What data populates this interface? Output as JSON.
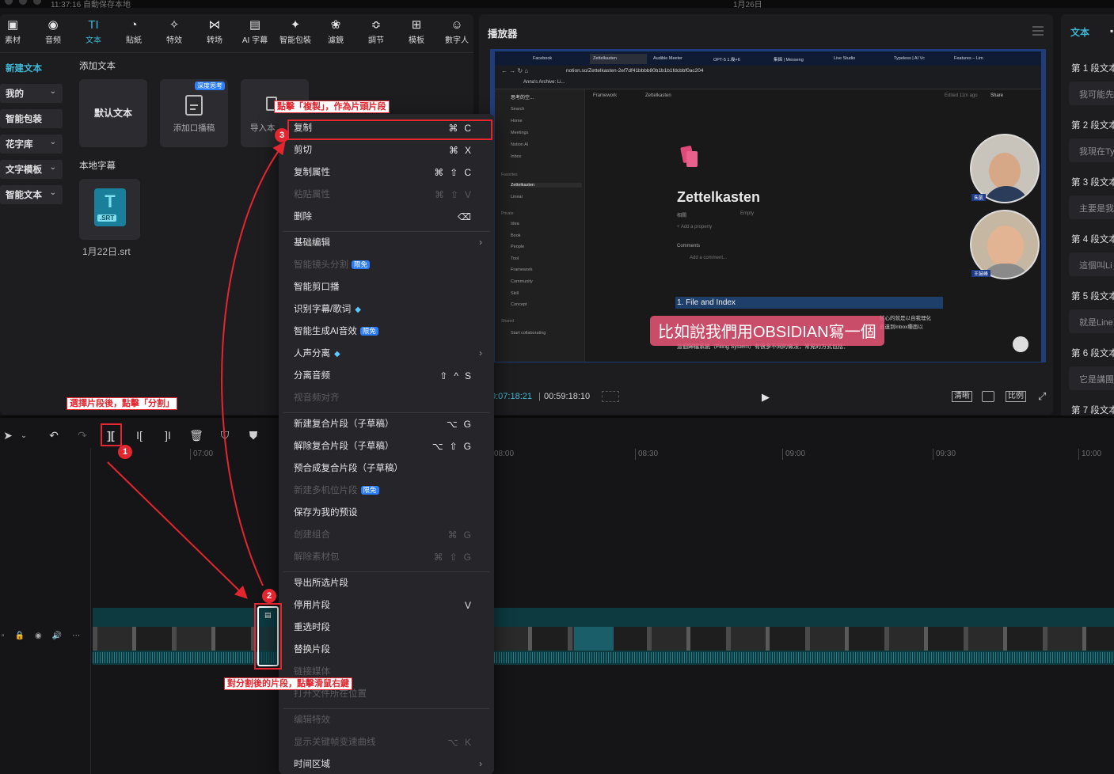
{
  "system": {
    "status": "11:37:16 自動保存本地",
    "date": "1月26日"
  },
  "toolbar": {
    "items": [
      {
        "label": "素材",
        "icon": "media-icon",
        "glyph": "▣"
      },
      {
        "label": "音频",
        "icon": "audio-icon",
        "glyph": "◉"
      },
      {
        "label": "文本",
        "icon": "text-icon",
        "glyph": "TI"
      },
      {
        "label": "貼紙",
        "icon": "sticker-icon",
        "glyph": "◔"
      },
      {
        "label": "特效",
        "icon": "effects-icon",
        "glyph": "✧"
      },
      {
        "label": "转场",
        "icon": "transition-icon",
        "glyph": "⋈"
      },
      {
        "label": "AI 字幕",
        "icon": "ai-caption-icon",
        "glyph": "▤"
      },
      {
        "label": "智能包裝",
        "icon": "smart-pack-icon",
        "glyph": "✦"
      },
      {
        "label": "濾鏡",
        "icon": "filter-icon",
        "glyph": "❀"
      },
      {
        "label": "調节",
        "icon": "adjust-icon",
        "glyph": "≎"
      },
      {
        "label": "模板",
        "icon": "template-icon",
        "glyph": "⊞"
      },
      {
        "label": "數字人",
        "icon": "avatar-icon",
        "glyph": "☺"
      }
    ]
  },
  "sidebar": {
    "items": [
      {
        "label": "新建文本",
        "chevron": false
      },
      {
        "label": "我的",
        "chevron": true
      },
      {
        "label": "智能包装",
        "chevron": false
      },
      {
        "label": "花字库",
        "chevron": true
      },
      {
        "label": "文字模板",
        "chevron": true
      },
      {
        "label": "智能文本",
        "chevron": true
      }
    ]
  },
  "text_panel": {
    "add_text_title": "添加文本",
    "default_text": "默认文本",
    "add_narration": "添加口播稿",
    "deep_think_badge": "深度思考",
    "import_label": "导入本",
    "local_caption_title": "本地字幕",
    "srt_badge": ".SRT",
    "srt_file": "1月22日.srt"
  },
  "player": {
    "title": "播放器",
    "current_time": "00:07:18:21",
    "duration": "00:59:18:10",
    "btn_clear": "清晰",
    "btn_ratio": "比例",
    "video": {
      "browser_tabs": [
        "Facebook",
        "Zettelkasten",
        "Audible Meeter",
        "OPT-5 1.幾+6",
        "集錦 | Messeng",
        "Live Studio",
        "Typeless | AI Vc",
        "Features – Lim"
      ],
      "url": "notion.so/Zettelkasten-2ef7df41bbbb80b1b1b1fdcbbf0ac204",
      "bookmark": "Anna's Archive: Li...",
      "workspace": "思考的空...",
      "sidebar_items": [
        "Search",
        "Home",
        "Meetings",
        "Notion AI",
        "Inbox"
      ],
      "favorites_label": "Favorites",
      "favorites": [
        "Zettelkasten",
        "Linear"
      ],
      "private_label": "Private",
      "private_items": [
        "Idea",
        "Book",
        "People",
        "Tool",
        "Framework",
        "Community",
        "Skill",
        "Concept"
      ],
      "shared_label": "Shared",
      "shared_item": "Start collaborating",
      "breadcrumb": [
        "Framework",
        "Zettelkasten"
      ],
      "edited": "Edited 11m ago",
      "share": "Share",
      "page_title": "Zettelkasten",
      "prop_name": "相關",
      "prop_value": "Empty",
      "add_property": "+ Add a property",
      "comments_label": "Comments",
      "add_comment": "Add a comment...",
      "heading": "1. File and Index",
      "body_right1": "核心的就是以自我理化",
      "body_right2": "直遺到Inbox種面以",
      "body_line": "這個歸檔系統（Filing System）有很多不同的做法，常見的方式包括：",
      "subtitle": "比如說我們用OBSIDIAN寫一個",
      "cam1_name": "朱凱",
      "cam2_name": "王鼓峰"
    }
  },
  "right_panel": {
    "tab": "文本",
    "segments": [
      {
        "title": "第 1 段文本",
        "text": "我可能先"
      },
      {
        "title": "第 2 段文本",
        "text": "我現在Ty"
      },
      {
        "title": "第 3 段文本",
        "text": "主要是我"
      },
      {
        "title": "第 4 段文本",
        "text": "這個叫Li"
      },
      {
        "title": "第 5 段文本",
        "text": "就是Line"
      },
      {
        "title": "第 6 段文本",
        "text": "它是講團"
      },
      {
        "title": "第 7 段文本",
        "text": ""
      }
    ]
  },
  "timeline": {
    "ticks": [
      "07:00",
      "08:00",
      "08:30",
      "09:00",
      "09:30",
      "10:00"
    ]
  },
  "context_menu": {
    "items": [
      {
        "label": "复制",
        "shortcut": "⌘C",
        "enabled": true,
        "highlight": true
      },
      {
        "label": "剪切",
        "shortcut": "⌘X",
        "enabled": true
      },
      {
        "label": "复制属性",
        "shortcut": "⌘⇧C",
        "enabled": true
      },
      {
        "label": "粘贴属性",
        "shortcut": "⌘⇧V",
        "enabled": false
      },
      {
        "label": "删除",
        "shortcut": "⌫",
        "enabled": true
      },
      {
        "label": "基础编辑",
        "submenu": true,
        "enabled": true
      },
      {
        "label": "智能镜头分割",
        "badge": "限免",
        "enabled": false
      },
      {
        "label": "智能剪口播",
        "enabled": true
      },
      {
        "label": "识别字幕/歌词",
        "gem": true,
        "enabled": true
      },
      {
        "label": "智能生成AI音效",
        "badge": "限免",
        "enabled": true
      },
      {
        "label": "人声分离",
        "gem": true,
        "submenu": true,
        "enabled": true
      },
      {
        "label": "分离音频",
        "shortcut": "⇧^S",
        "enabled": true
      },
      {
        "label": "视音频对齐",
        "enabled": false
      },
      {
        "label": "新建复合片段（子草稿）",
        "shortcut": "⌥G",
        "enabled": true
      },
      {
        "label": "解除复合片段（子草稿）",
        "shortcut": "⌥⇧G",
        "enabled": true
      },
      {
        "label": "预合成复合片段（子草稿）",
        "enabled": true
      },
      {
        "label": "新建多机位片段",
        "badge": "限免",
        "enabled": false
      },
      {
        "label": "保存为我的预设",
        "enabled": true
      },
      {
        "label": "创建组合",
        "shortcut": "⌘G",
        "enabled": false
      },
      {
        "label": "解除素材包",
        "shortcut": "⌘⇧G",
        "enabled": false
      },
      {
        "label": "导出所选片段",
        "enabled": true
      },
      {
        "label": "停用片段",
        "shortcut": "V",
        "enabled": true
      },
      {
        "label": "重选时段",
        "enabled": true
      },
      {
        "label": "替换片段",
        "enabled": true
      },
      {
        "label": "链接媒体",
        "enabled": false
      },
      {
        "label": "打开文件所在位置",
        "enabled": false
      },
      {
        "label": "编辑特效",
        "enabled": false
      },
      {
        "label": "显示关键帧变速曲线",
        "shortcut": "⌥K",
        "enabled": false
      },
      {
        "label": "时间区域",
        "submenu": true,
        "enabled": true
      }
    ]
  },
  "annotations": {
    "note1": "選擇片段後，點擊「分割」",
    "note2": "對分割後的片段，點擊滑鼠右鍵",
    "note3": "點擊「複製」，作為片頭片段",
    "n1": "1",
    "n2": "2",
    "n3": "3"
  },
  "colors": {
    "accent": "#3fb8d6",
    "annotation": "#e3262f",
    "panel": "#1d1d20",
    "menu": "#26262a",
    "track": "#0d3a41"
  }
}
